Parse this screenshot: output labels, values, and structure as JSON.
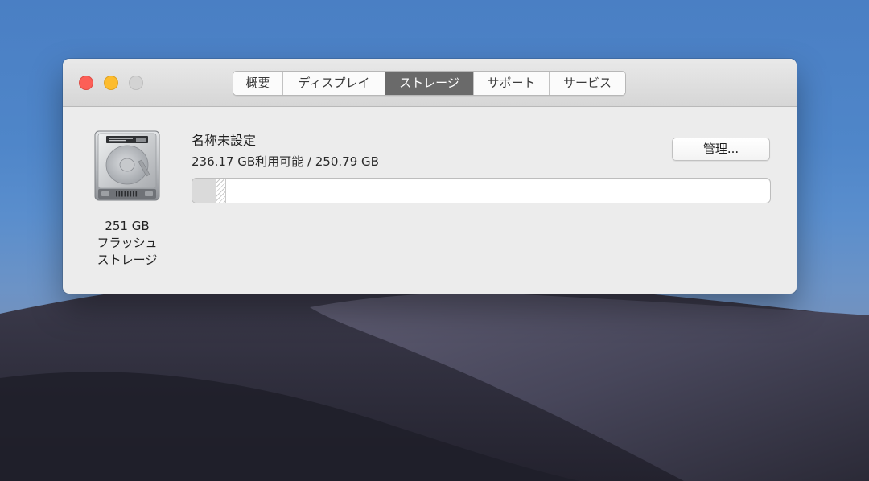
{
  "window": {
    "tabs": [
      {
        "label": "概要"
      },
      {
        "label": "ディスプレイ"
      },
      {
        "label": "ストレージ",
        "active": true
      },
      {
        "label": "サポート"
      },
      {
        "label": "サービス"
      }
    ]
  },
  "disk": {
    "size_label": "251 GB",
    "type_line1": "フラッシュ",
    "type_line2": "ストレージ",
    "icon": "hard-drive-icon"
  },
  "volume": {
    "name": "名称未設定",
    "info": "236.17 GB利用可能 / 250.79 GB",
    "manage_label": "管理...",
    "used_fraction": 0.0417,
    "other_fraction": 0.0152
  },
  "colors": {
    "close": "#fc5f57",
    "minimize": "#fdbc2e",
    "zoom_disabled": "#d3d3d3",
    "active_tab": "#6a6a6a"
  }
}
